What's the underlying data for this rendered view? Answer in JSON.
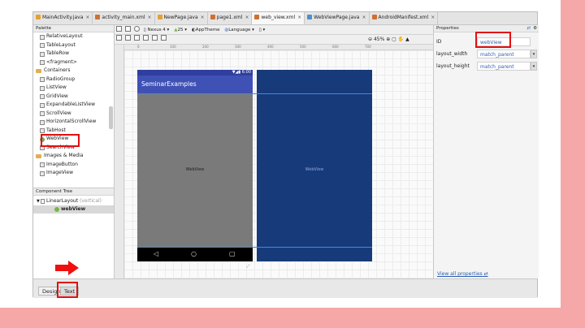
{
  "tabs": [
    {
      "label": "MainActivity.java",
      "color": "#e8a030"
    },
    {
      "label": "activity_main.xml",
      "color": "#d07030"
    },
    {
      "label": "NewPage.java",
      "color": "#e8a030"
    },
    {
      "label": "page1.xml",
      "color": "#d07030"
    },
    {
      "label": "web_view.xml",
      "color": "#d07030",
      "active": true
    },
    {
      "label": "WebViewPage.java",
      "color": "#4a90d0"
    },
    {
      "label": "AndroidManifest.xml",
      "color": "#d07030"
    }
  ],
  "tab_close": "×",
  "palette": {
    "header": "Palette",
    "items": [
      {
        "label": "RelativeLayout",
        "kind": "item"
      },
      {
        "label": "TableLayout",
        "kind": "item"
      },
      {
        "label": "TableRow",
        "kind": "item"
      },
      {
        "label": "<fragment>",
        "kind": "item"
      },
      {
        "label": "Containers",
        "kind": "folder"
      },
      {
        "label": "RadioGroup",
        "kind": "item"
      },
      {
        "label": "ListView",
        "kind": "item"
      },
      {
        "label": "GridView",
        "kind": "item"
      },
      {
        "label": "ExpandableListView",
        "kind": "item"
      },
      {
        "label": "ScrollView",
        "kind": "item"
      },
      {
        "label": "HorizontalScrollView",
        "kind": "item"
      },
      {
        "label": "TabHost",
        "kind": "item"
      },
      {
        "label": "WebView",
        "kind": "item",
        "highlight": true
      },
      {
        "label": "SearchView",
        "kind": "item"
      },
      {
        "label": "Images & Media",
        "kind": "folder"
      },
      {
        "label": "ImageButton",
        "kind": "item"
      },
      {
        "label": "ImageView",
        "kind": "item"
      }
    ]
  },
  "component_tree": {
    "header": "Component Tree",
    "root_label": "LinearLayout",
    "root_suffix": "(vertical)",
    "child_label": "webView"
  },
  "toolbar": {
    "device": "Nexus 4",
    "api": "25",
    "theme": "AppTheme",
    "language": "Language",
    "zoom": "45%"
  },
  "ruler_ticks": [
    "0",
    "100",
    "200",
    "300",
    "400",
    "500",
    "600",
    "700"
  ],
  "phone": {
    "time": "6:00",
    "app_title": "SeminarExamples",
    "content_label": "WebView",
    "blueprint_label": "WebView",
    "colors": {
      "appbar": "#3f51b5",
      "statusbar": "#303f9f",
      "content": "#7a7a7a",
      "blueprint": "#173a7a",
      "navbar": "#000000"
    }
  },
  "properties": {
    "header": "Properties",
    "rows": [
      {
        "name": "ID",
        "value": "webView",
        "highlight": true
      },
      {
        "name": "layout_width",
        "value": "match_parent"
      },
      {
        "name": "layout_height",
        "value": "match_parent"
      }
    ],
    "all_link": "View all properties"
  },
  "bottom_tabs": {
    "design": "Design",
    "text": "Text"
  },
  "colors": {
    "highlight_box": "#e01010",
    "arrow": "#f01010",
    "strip": "#f6a7a7"
  }
}
